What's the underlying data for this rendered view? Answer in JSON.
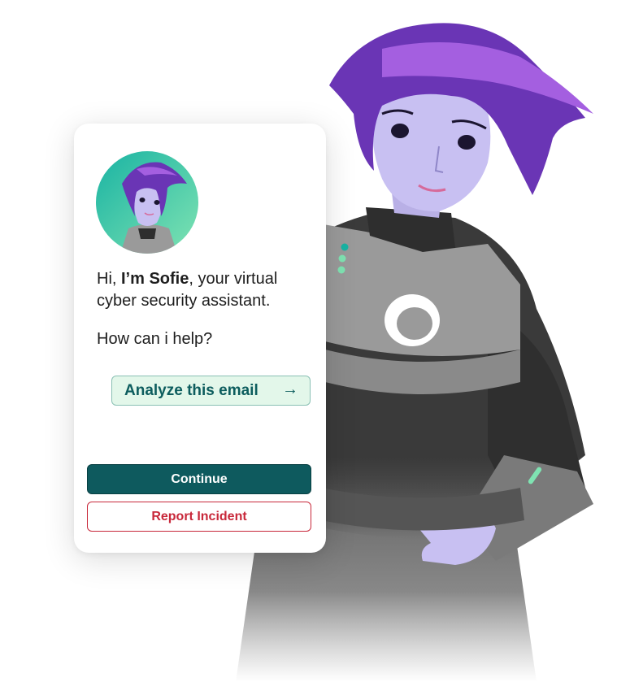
{
  "assistant": {
    "name_bold": "I’m Sofie",
    "greeting_prefix": "Hi, ",
    "greeting_suffix": ", your virtual cyber security assistant.",
    "question": "How can i help?"
  },
  "suggestion": {
    "label": "Analyze this email",
    "arrow": "→"
  },
  "actions": {
    "continue_label": "Continue",
    "report_label": "Report Incident"
  },
  "icons": {
    "character": "sofie-character-illustration",
    "avatar": "sofie-avatar-icon",
    "arrow": "arrow-right-icon"
  },
  "colors": {
    "primary": "#0e5a5e",
    "danger": "#c8283a",
    "suggest_bg": "#e3f7ea",
    "hair": "#6a35b5",
    "skin": "#c8c0f2"
  }
}
